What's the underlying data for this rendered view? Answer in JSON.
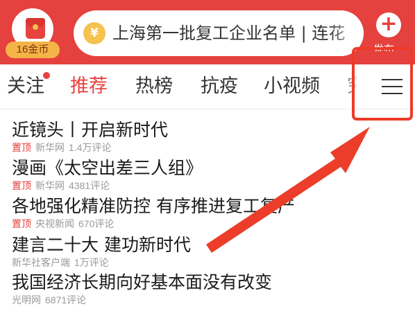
{
  "header": {
    "coin_badge": "16金币",
    "search_text": "上海第一批复工企业名单 | 连花",
    "publish_icon": "+",
    "publish_label": "发布",
    "yuan_symbol": "¥"
  },
  "tabs": [
    {
      "label": "关注",
      "has_dot": true
    },
    {
      "label": "推荐",
      "active": true
    },
    {
      "label": "热榜"
    },
    {
      "label": "抗疫"
    },
    {
      "label": "小视频"
    },
    {
      "label": "究"
    }
  ],
  "menu_icon": "hamburger-menu-icon",
  "colors": {
    "brand_red": "#e5413e",
    "callout_red": "#ee3a28"
  },
  "news": [
    {
      "title": "近镜头丨开启新时代",
      "pinned": "置顶",
      "source": "新华网",
      "comments": "1.4万评论"
    },
    {
      "title": "漫画《太空出差三人组》",
      "pinned": "置顶",
      "source": "新华网",
      "comments": "4381评论"
    },
    {
      "title": "各地强化精准防控 有序推进复工复产",
      "pinned": "置顶",
      "source": "央视新闻",
      "comments": "670评论"
    },
    {
      "title": "建言二十大 建功新时代",
      "pinned": "",
      "source": "新华社客户端",
      "comments": "1万评论"
    },
    {
      "title": "我国经济长期向好基本面没有改变",
      "pinned": "",
      "source": "光明网",
      "comments": "6871评论"
    }
  ]
}
